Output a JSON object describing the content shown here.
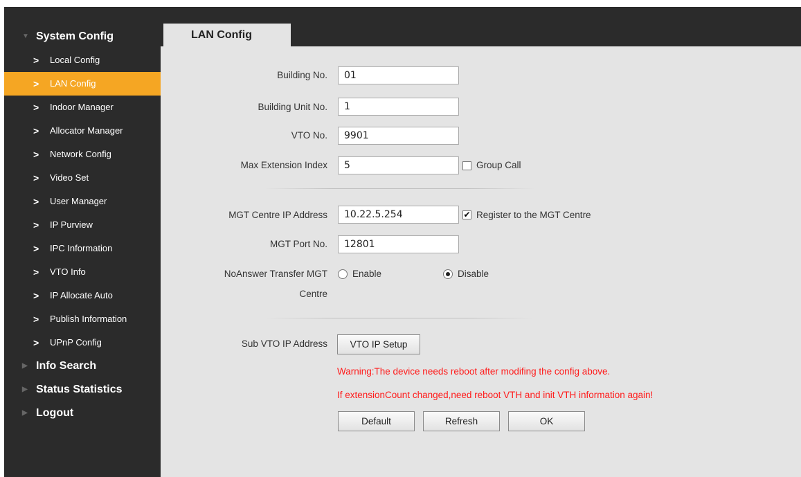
{
  "sidebar": {
    "system_config": "System Config",
    "items": [
      {
        "label": "Local Config"
      },
      {
        "label": "LAN Config"
      },
      {
        "label": "Indoor Manager"
      },
      {
        "label": "Allocator Manager"
      },
      {
        "label": "Network Config"
      },
      {
        "label": "Video Set"
      },
      {
        "label": "User Manager"
      },
      {
        "label": "IP Purview"
      },
      {
        "label": "IPC Information"
      },
      {
        "label": "VTO Info"
      },
      {
        "label": "IP Allocate Auto"
      },
      {
        "label": "Publish Information"
      },
      {
        "label": "UPnP Config"
      }
    ],
    "info_search": "Info Search",
    "status_statistics": "Status Statistics",
    "logout": "Logout"
  },
  "tab": {
    "title": "LAN Config"
  },
  "form": {
    "building_no": {
      "label": "Building No.",
      "value": "01"
    },
    "building_unit_no": {
      "label": "Building Unit No.",
      "value": "1"
    },
    "vto_no": {
      "label": "VTO No.",
      "value": "9901"
    },
    "max_extension_index": {
      "label": "Max Extension Index",
      "value": "5"
    },
    "group_call": {
      "label": "Group Call",
      "checked": false
    },
    "mgt_centre_ip": {
      "label": "MGT Centre IP Address",
      "value": "10.22.5.254"
    },
    "register_mgt": {
      "label": "Register to the MGT Centre",
      "checked": true,
      "mark": "✔"
    },
    "mgt_port": {
      "label": "MGT Port No.",
      "value": "12801"
    },
    "noanswer": {
      "label_line1": "NoAnswer Transfer MGT",
      "label_line2": "Centre",
      "enable": "Enable",
      "disable": "Disable",
      "selected": "Disable"
    },
    "sub_vto": {
      "label": "Sub VTO IP Address",
      "button": "VTO IP Setup"
    }
  },
  "warnings": {
    "reboot": "Warning:The device needs reboot after modifing the config above.",
    "extension": "If extensionCount changed,need reboot VTH and init VTH information again!"
  },
  "buttons": {
    "default": "Default",
    "refresh": "Refresh",
    "ok": "OK"
  },
  "colors": {
    "sidebar_bg": "#2b2b2b",
    "active": "#f5a623",
    "content_bg": "#e4e4e4",
    "warning": "#ff1a1a"
  }
}
